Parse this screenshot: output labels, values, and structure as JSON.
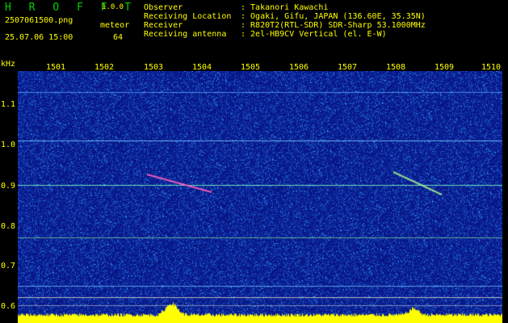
{
  "header": {
    "app_title": "H R O F F T",
    "version": "1.0.0",
    "filename": "2507061500.png",
    "datetime": "25.07.06 15:00",
    "mode_label": "meteor",
    "count": "64",
    "fields": [
      {
        "label": "Observer",
        "value": ": Takanori Kawachi"
      },
      {
        "label": "Receiving Location",
        "value": ": Ogaki, Gifu, JAPAN (136.60E, 35.35N)"
      },
      {
        "label": "Receiver",
        "value": ": R820T2(RTL-SDR) SDR-Sharp 53.1000MHz"
      },
      {
        "label": "Receiving antenna",
        "value": ": 2el-HB9CV Vertical (el. E-W)"
      }
    ]
  },
  "axes": {
    "y_unit": "kHz",
    "x_ticks": [
      "1501",
      "1502",
      "1503",
      "1504",
      "1505",
      "1506",
      "1507",
      "1508",
      "1509",
      "1510"
    ],
    "y_ticks": [
      "1.1",
      "1.0",
      "0.9",
      "0.8",
      "0.7",
      "0.6"
    ]
  },
  "colors": {
    "background": "#000000",
    "plot_noise_base": "#0a1a8c",
    "text_yellow": "#ffff00",
    "title_green": "#00d000",
    "meteor_trace": "#ff60c0",
    "signal_line": "#3fa8ff"
  }
}
